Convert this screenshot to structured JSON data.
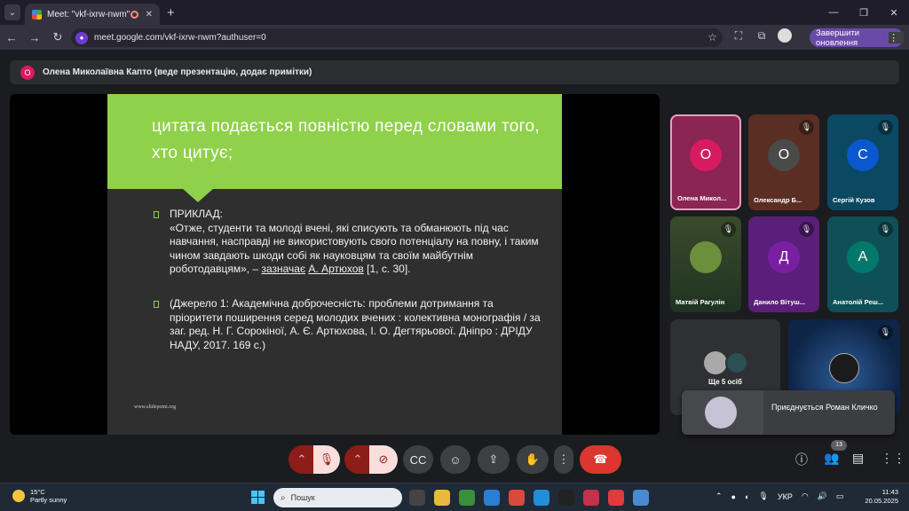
{
  "browser": {
    "tab_title": "Meet: \"vkf-ixrw-nwm\"",
    "url": "meet.google.com/vkf-ixrw-nwm?authuser=0",
    "update_label": "Завершити оновлення"
  },
  "banner": {
    "avatar_letter": "О",
    "text": "Олена Миколаївна Капто (веде презентацію, додає примітки)"
  },
  "slide": {
    "title": "цитата подається повністю перед словами того, хто цитує;",
    "example_label": "ПРИКЛАД:",
    "quote_text": "«Отже, студенти та молоді вчені, які списують та обманюють під час навчання, насправді не використовують свого потенціалу на повну, і таким чином завдають шкоди собі як науковцям та своїм майбутнім роботодавцям», –",
    "quote_says": "зазначає",
    "quote_author": "А. Артюхов",
    "quote_ref": "[1, с. 30].",
    "source_text": "(Джерело 1: Академічна доброчесність: проблеми дотримання та пріоритети поширення серед молодих вчених : колективна монографія / за заг. ред. Н. Г. Сорокіної, А. Є. Артюхова, І. О. Дегтярьової. Дніпро : ДРІДУ НАДУ, 2017. 169 с.)",
    "site": "www.slidepoint.org"
  },
  "participants": [
    {
      "letter": "О",
      "name": "Олена Микол...",
      "color": "#d81b60"
    },
    {
      "letter": "О",
      "name": "Олександр Б...",
      "color": "#4a4a4a"
    },
    {
      "letter": "С",
      "name": "Сергій Кузов",
      "color": "#0b57d0"
    },
    {
      "letter": "",
      "name": "Матвій Рагулін",
      "color": "#3d6b2f"
    },
    {
      "letter": "Д",
      "name": "Данило Вітуш...",
      "color": "#7b1fa2"
    },
    {
      "letter": "А",
      "name": "Анатолій Реш...",
      "color": "#00796b"
    }
  ],
  "more": {
    "label": "Ще 5 осіб"
  },
  "toast": {
    "text": "Приєднується Роман Кличко"
  },
  "controls": {
    "people_count": "13"
  },
  "taskbar": {
    "temp": "15°C",
    "weather": "Partly sunny",
    "search_placeholder": "Пошук",
    "lang": "УКР",
    "time": "11:43",
    "date": "20.05.2025"
  }
}
